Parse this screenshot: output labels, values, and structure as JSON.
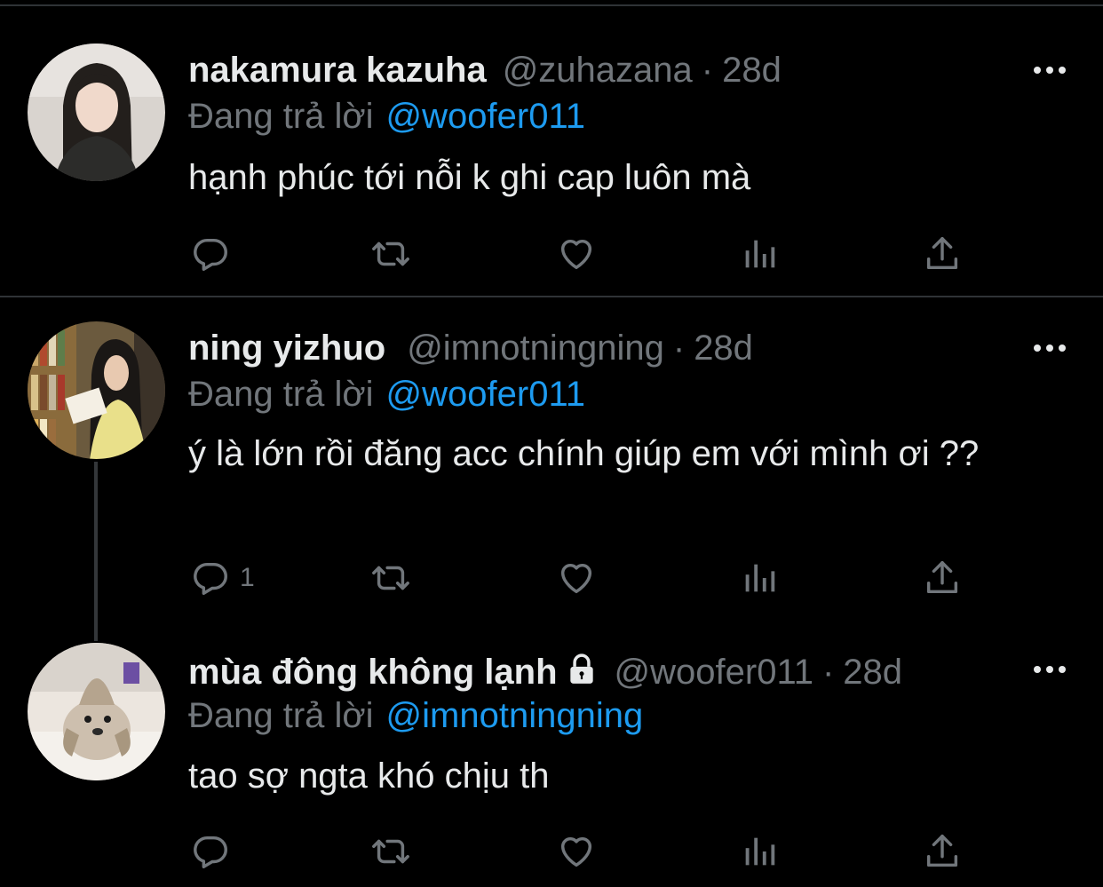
{
  "tweets": [
    {
      "name": "nakamura kazuha",
      "handle": "@zuhazana",
      "separator": "·",
      "time": "28d",
      "replying_prefix": "Đang trả lời",
      "replying_to": "@woofer011",
      "text": "hạnh phúc tới nỗi k ghi cap luôn mà",
      "reply_count": "",
      "locked": false
    },
    {
      "name": "ning yizhuo",
      "handle": "@imnotningning",
      "separator": "·",
      "time": "28d",
      "replying_prefix": "Đang trả lời",
      "replying_to": "@woofer011",
      "text": "ý là lớn rồi đăng acc chính giúp em với mình ơi ??",
      "reply_count": "1",
      "locked": false
    },
    {
      "name": "mùa đông không lạnh",
      "handle": "@woofer011",
      "separator": "·",
      "time": "28d",
      "replying_prefix": "Đang trả lời",
      "replying_to": "@imnotningning",
      "text": "tao sợ ngta khó chịu th",
      "reply_count": "",
      "locked": true
    }
  ],
  "icons": {
    "reply": "reply-icon",
    "retweet": "retweet-icon",
    "like": "heart-icon",
    "views": "analytics-icon",
    "share": "share-icon",
    "more": "more-icon",
    "lock": "lock-icon"
  },
  "colors": {
    "background": "#000000",
    "text": "#e7e9ea",
    "secondary": "#71767b",
    "accent": "#1d9bf0",
    "divider": "#2f3336"
  }
}
